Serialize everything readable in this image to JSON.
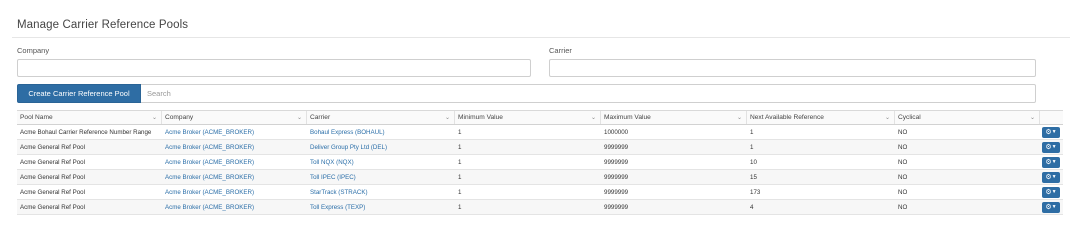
{
  "page": {
    "title": "Manage Carrier Reference Pools"
  },
  "filters": {
    "company_label": "Company",
    "company_value": "",
    "carrier_label": "Carrier",
    "carrier_value": ""
  },
  "toolbar": {
    "create_label": "Create Carrier Reference Pool",
    "search_placeholder": "Search",
    "search_value": ""
  },
  "table": {
    "columns": [
      "Pool Name",
      "Company",
      "Carrier",
      "Minimum Value",
      "Maximum Value",
      "Next Available Reference",
      "Cyclical"
    ],
    "rows": [
      [
        "Acme Bohaul Carrier Reference Number Range",
        "Acme Broker (ACME_BROKER)",
        "Bohaul Express (BOHAUL)",
        "1",
        "1000000",
        "1",
        "NO"
      ],
      [
        "Acme General Ref Pool",
        "Acme Broker (ACME_BROKER)",
        "Deliver Group Pty Ltd (DEL)",
        "1",
        "9999999",
        "1",
        "NO"
      ],
      [
        "Acme General Ref Pool",
        "Acme Broker (ACME_BROKER)",
        "Toll NQX (NQX)",
        "1",
        "9999999",
        "10",
        "NO"
      ],
      [
        "Acme General Ref Pool",
        "Acme Broker (ACME_BROKER)",
        "Toll IPEC (IPEC)",
        "1",
        "9999999",
        "15",
        "NO"
      ],
      [
        "Acme General Ref Pool",
        "Acme Broker (ACME_BROKER)",
        "StarTrack (STRACK)",
        "1",
        "9999999",
        "173",
        "NO"
      ],
      [
        "Acme General Ref Pool",
        "Acme Broker (ACME_BROKER)",
        "Toll Express (TEXP)",
        "1",
        "9999999",
        "4",
        "NO"
      ]
    ],
    "row_action_icon": "gear-icon",
    "sort_icon": "chevron-down-icon"
  },
  "colors": {
    "primary": "#2e6da4",
    "link": "#2a6ea8",
    "border": "#cfcfcf"
  }
}
